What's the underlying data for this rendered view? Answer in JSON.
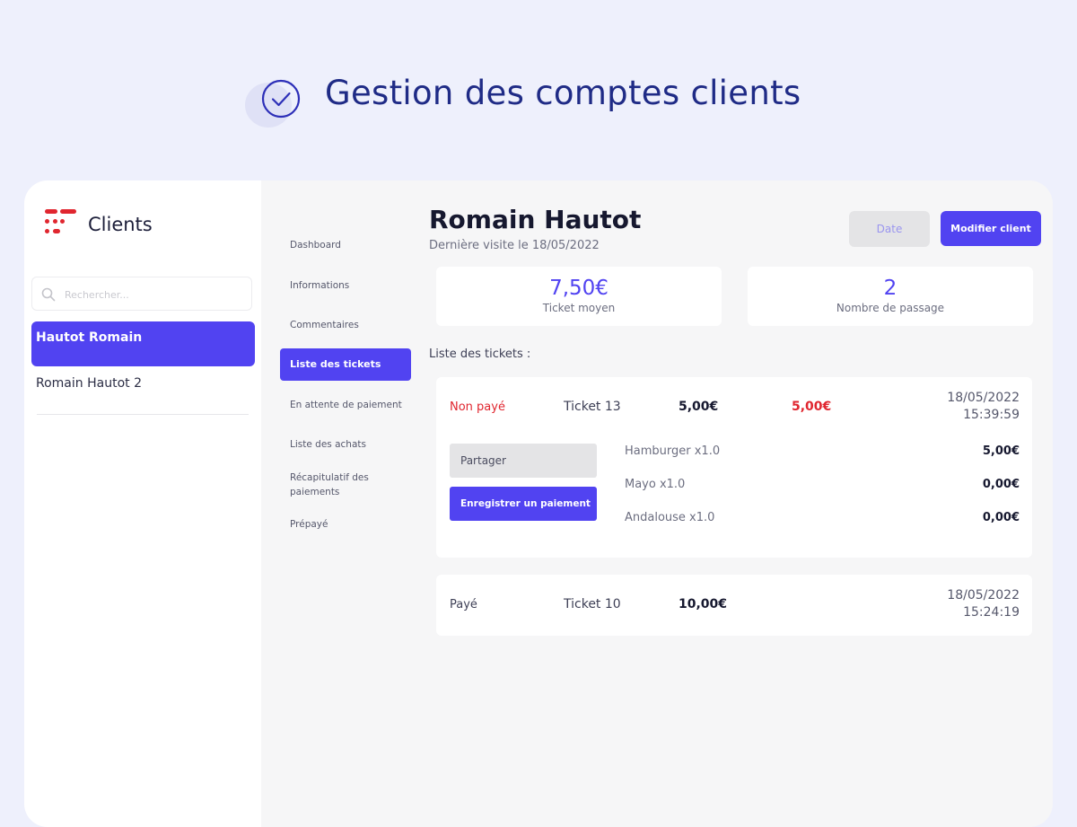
{
  "hero": {
    "title": "Gestion des comptes clients",
    "icon": "check-circle-icon"
  },
  "colors": {
    "accent": "#5143f1",
    "danger": "#e0262f",
    "page_bg": "#eef0fc"
  },
  "sidebar": {
    "app_title": "Clients",
    "search_placeholder": "Rechercher...",
    "clients": [
      {
        "name": "Hautot Romain",
        "active": true
      },
      {
        "name": "Romain Hautot 2",
        "active": false
      }
    ]
  },
  "nav": {
    "items": [
      {
        "label": "Dashboard"
      },
      {
        "label": "Informations"
      },
      {
        "label": "Commentaires"
      },
      {
        "label": "Liste des tickets",
        "active": true
      },
      {
        "label": "En attente de paiement"
      },
      {
        "label": "Liste des achats"
      },
      {
        "label": "Récapitulatif des paiements"
      },
      {
        "label": "Prépayé"
      }
    ]
  },
  "client": {
    "name": "Romain Hautot",
    "last_visit": "Dernière visite le 18/05/2022",
    "date_button": "Date",
    "modify_button": "Modifier client"
  },
  "stats": [
    {
      "value": "7,50€",
      "label": "Ticket moyen"
    },
    {
      "value": "2",
      "label": "Nombre de passage"
    }
  ],
  "tickets_title": "Liste des tickets :",
  "tickets": [
    {
      "status": "Non payé",
      "name": "Ticket 13",
      "amount": "5,00€",
      "due": "5,00€",
      "date": "18/05/2022",
      "time": "15:39:59",
      "share_button": "Partager",
      "pay_button": "Enregistrer un paiement",
      "lines": [
        {
          "name": "Hamburger x1.0",
          "price": "5,00€"
        },
        {
          "name": "Mayo x1.0",
          "price": "0,00€"
        },
        {
          "name": "Andalouse x1.0",
          "price": "0,00€"
        }
      ]
    },
    {
      "status": "Payé",
      "name": "Ticket 10",
      "amount": "10,00€",
      "date": "18/05/2022",
      "time": "15:24:19"
    }
  ]
}
